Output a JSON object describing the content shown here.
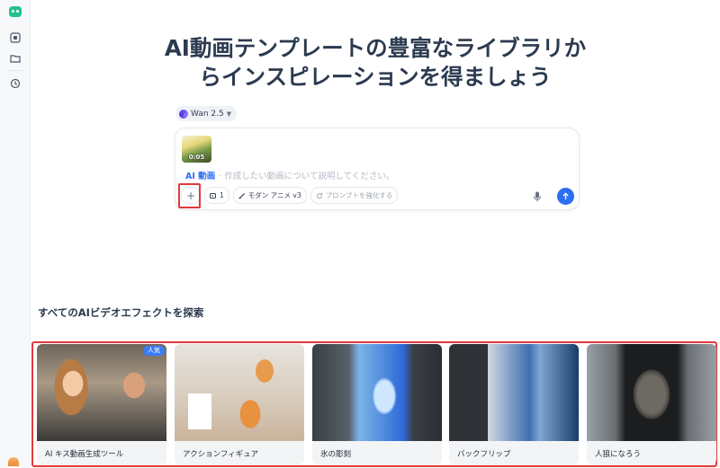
{
  "hero": {
    "line1": "AI動画テンプレートの豊富なライブラリか",
    "line2": "らインスピレーションを得ましょう"
  },
  "model": {
    "name": "Wan 2.5"
  },
  "composer": {
    "attachment_duration": "0:05",
    "ai_tag": "AI 動画",
    "placeholder": "· 作成したい動画について説明してください。",
    "count_label": "1",
    "style_label": "モダン アニメ v3",
    "enhance_label": "プロンプトを強化する"
  },
  "section": {
    "title": "すべてのAIビデオエフェクトを探索"
  },
  "cards": [
    {
      "label": "AI キス動画生成ツール",
      "badge": "人気"
    },
    {
      "label": "アクションフィギュア"
    },
    {
      "label": "氷の彫刻"
    },
    {
      "label": "バックフリップ"
    },
    {
      "label": "人狼になろう"
    }
  ],
  "colors": {
    "accent": "#2d6ff2",
    "highlight": "#e23a3a",
    "brand": "#22c08d"
  }
}
